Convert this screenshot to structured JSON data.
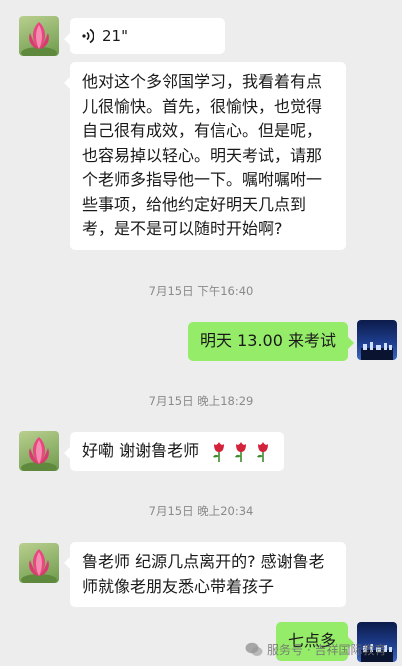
{
  "conversation": {
    "messages": [
      {
        "sender": "other",
        "type": "voice",
        "duration": "21\""
      },
      {
        "sender": "other",
        "type": "text",
        "text": "他对这个多邻国学习，我看着有点儿很愉快。首先，很愉快，也觉得自己很有成效，有信心。但是呢，也容易掉以轻心。明天考试，请那个老师多指导他一下。嘱咐嘱咐一些事项，给他约定好明天几点到考，是不是可以随时开始啊?"
      },
      {
        "type": "timestamp",
        "text": "7月15日 下午16:40"
      },
      {
        "sender": "self",
        "type": "text",
        "text": "明天 13.00 来考试"
      },
      {
        "type": "timestamp",
        "text": "7月15日 晚上18:29"
      },
      {
        "sender": "other",
        "type": "text",
        "text": "好嘞 谢谢鲁老师",
        "emoji": [
          "rose-icon",
          "rose-icon",
          "rose-icon"
        ]
      },
      {
        "type": "timestamp",
        "text": "7月15日 晚上20:34"
      },
      {
        "sender": "other",
        "type": "text",
        "text": "鲁老师 纪源几点离开的? 感谢鲁老师就像老朋友悉心带着孩子"
      },
      {
        "sender": "self",
        "type": "text",
        "text": "七点多"
      }
    ]
  },
  "watermark": {
    "text": "服务号 · 吉祥国际教育",
    "icon": "wechat-icon"
  },
  "colors": {
    "background": "#ededed",
    "other_bubble": "#ffffff",
    "self_bubble": "#95ec69",
    "timestamp_text": "#8a8a8a"
  }
}
